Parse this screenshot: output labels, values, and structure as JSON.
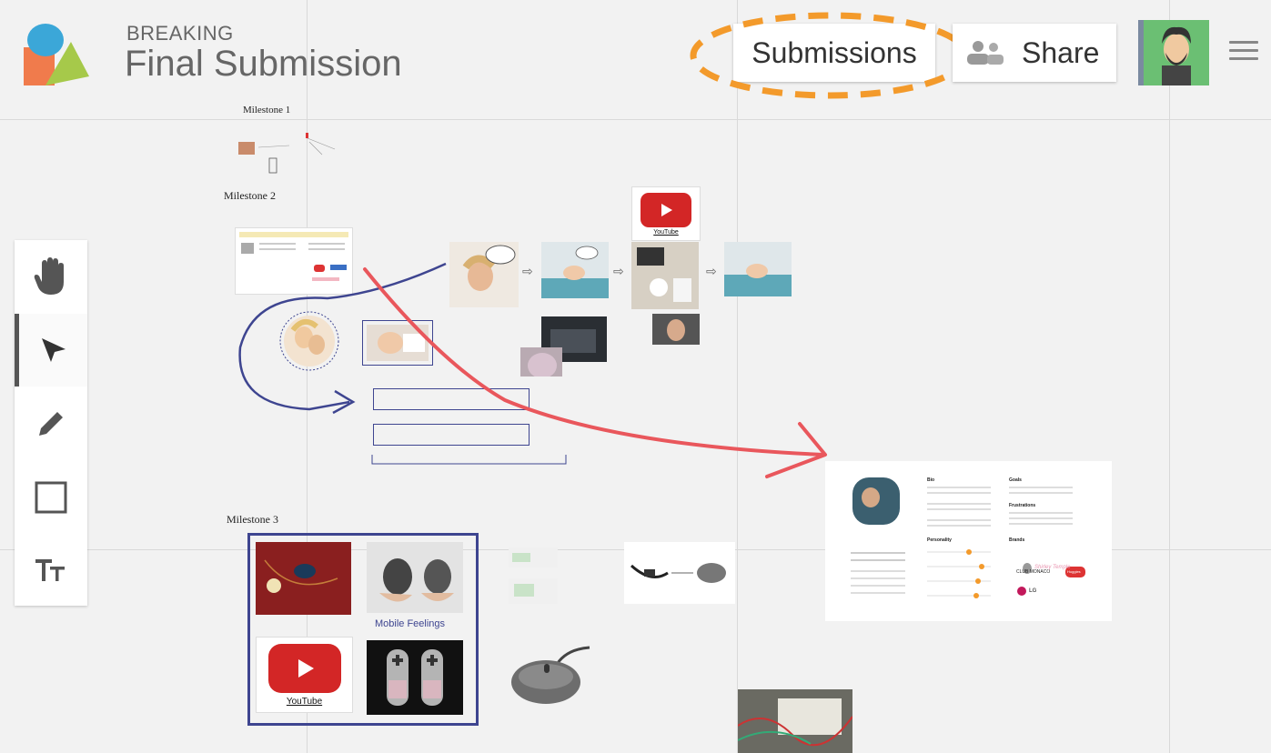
{
  "header": {
    "breadcrumb": "BREAKING",
    "title": "Final Submission",
    "submissions_label": "Submissions",
    "share_label": "Share"
  },
  "canvas": {
    "milestone1": "Milestone 1",
    "milestone2": "Milestone 2",
    "milestone3": "Milestone 3",
    "youtube1_caption": "YouTube",
    "youtube2_caption": "YouTube",
    "mobile_feelings": "Mobile Feelings",
    "persona_sections": [
      "Bio",
      "Goals",
      "Frustrations",
      "Personality",
      "Brands"
    ],
    "persona_brands": [
      "CLUB MONACO",
      "Huggies",
      "Shirley Temple",
      "LG"
    ]
  },
  "colors": {
    "accent_orange": "#f39a2b",
    "red_arrow": "#e9575c",
    "navy": "#3e4590",
    "youtube_red": "#d32626"
  },
  "tools": [
    "hand-icon",
    "pointer-icon",
    "pencil-icon",
    "rectangle-icon",
    "text-icon"
  ]
}
